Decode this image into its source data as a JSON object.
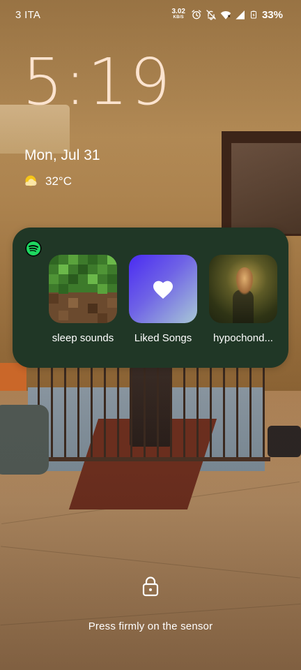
{
  "status_bar": {
    "carrier": "3 ITA",
    "net_speed_value": "3.02",
    "net_speed_unit": "KB/S",
    "battery_percent": "33%",
    "icons": [
      "alarm-icon",
      "mute-icon",
      "wifi-icon",
      "signal-icon",
      "battery-charging-icon"
    ]
  },
  "lockscreen": {
    "time": "5:19",
    "date": "Mon, Jul 31",
    "weather_temp": "32°C",
    "weather_icon": "partly-cloudy-icon",
    "hint": "Press firmly on the sensor"
  },
  "widget": {
    "app_icon": "spotify-icon",
    "items": [
      {
        "label": "sleep sounds",
        "art": "minecraft-grass-block-art"
      },
      {
        "label": "Liked Songs",
        "art": "heart-gradient-art"
      },
      {
        "label": "hypochond...",
        "art": "album-cover-art"
      }
    ]
  },
  "colors": {
    "clock": "#fbe3cf",
    "widget_bg": "#203726",
    "spotify_green": "#1ed760",
    "liked_gradient_start": "#4a2bf2",
    "liked_gradient_end": "#a8c8d6"
  }
}
